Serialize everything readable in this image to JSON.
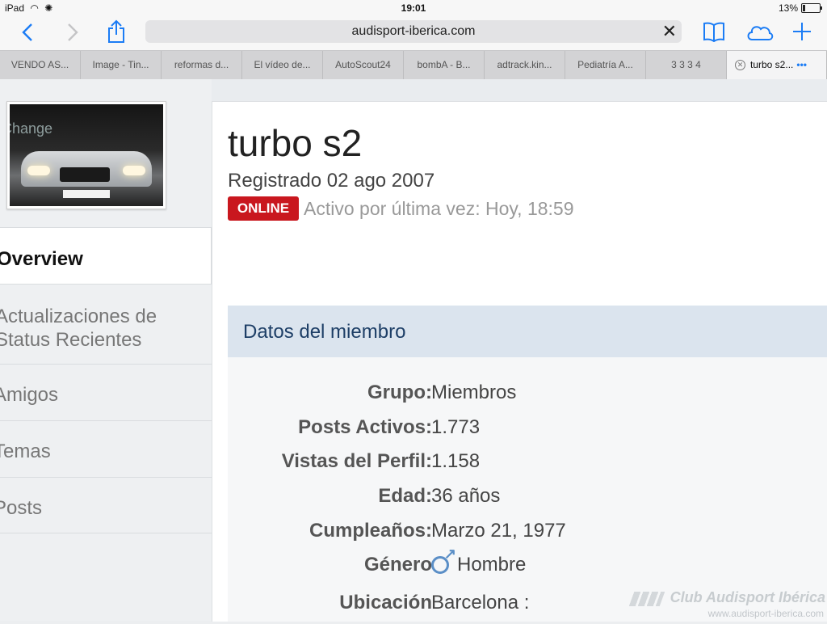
{
  "status_bar": {
    "device": "iPad",
    "wifi_icon": "wifi-icon",
    "time": "19:01",
    "battery": "13%",
    "battery_level": 0.13
  },
  "toolbar": {
    "url": "audisport-iberica.com",
    "icons": [
      "back-icon",
      "forward-icon",
      "share-icon",
      "clear-icon",
      "bookmarks-icon",
      "icloud-tabs-icon",
      "new-tab-icon"
    ]
  },
  "tabs": [
    {
      "label": "VENDO AS..."
    },
    {
      "label": "Image - Tin..."
    },
    {
      "label": "reformas d..."
    },
    {
      "label": "El vídeo de..."
    },
    {
      "label": "AutoScout24"
    },
    {
      "label": "bombA - B..."
    },
    {
      "label": "adtrack.kin..."
    },
    {
      "label": "Pediatría A..."
    },
    {
      "label": "3 3 3 4"
    },
    {
      "label": "turbo s2..."
    }
  ],
  "sidebar": {
    "avatar_change": "Change",
    "items": [
      {
        "label": "Overview"
      },
      {
        "label": "Actualizaciones de Status Recientes"
      },
      {
        "label": "Amigos"
      },
      {
        "label": "Temas"
      },
      {
        "label": "Posts"
      }
    ]
  },
  "profile": {
    "name": "turbo s2",
    "registered": "Registrado 02 ago 2007",
    "online": "ONLINE",
    "last_active": "Activo por última vez: Hoy, 18:59"
  },
  "member_panel": {
    "title": "Datos del miembro",
    "rows": [
      {
        "key": "Grupo:",
        "value": "Miembros"
      },
      {
        "key": "Posts Activos:",
        "value": "1.773"
      },
      {
        "key": "Vistas del Perfil:",
        "value": "1.158"
      },
      {
        "key": "Edad:",
        "value": "36 años"
      },
      {
        "key": "Cumpleaños:",
        "value": "Marzo 21, 1977"
      },
      {
        "key": "Género",
        "value": "Hombre"
      },
      {
        "key": "Ubicación",
        "value": "Barcelona :"
      }
    ]
  },
  "watermark": {
    "title": "Club Audisport Ibérica",
    "url": "www.audisport-iberica.com"
  },
  "colors": {
    "accent": "#1b7cf5",
    "online": "#c9171e",
    "panel_header": "#dbe4ee",
    "panel_title": "#1d3e66"
  }
}
